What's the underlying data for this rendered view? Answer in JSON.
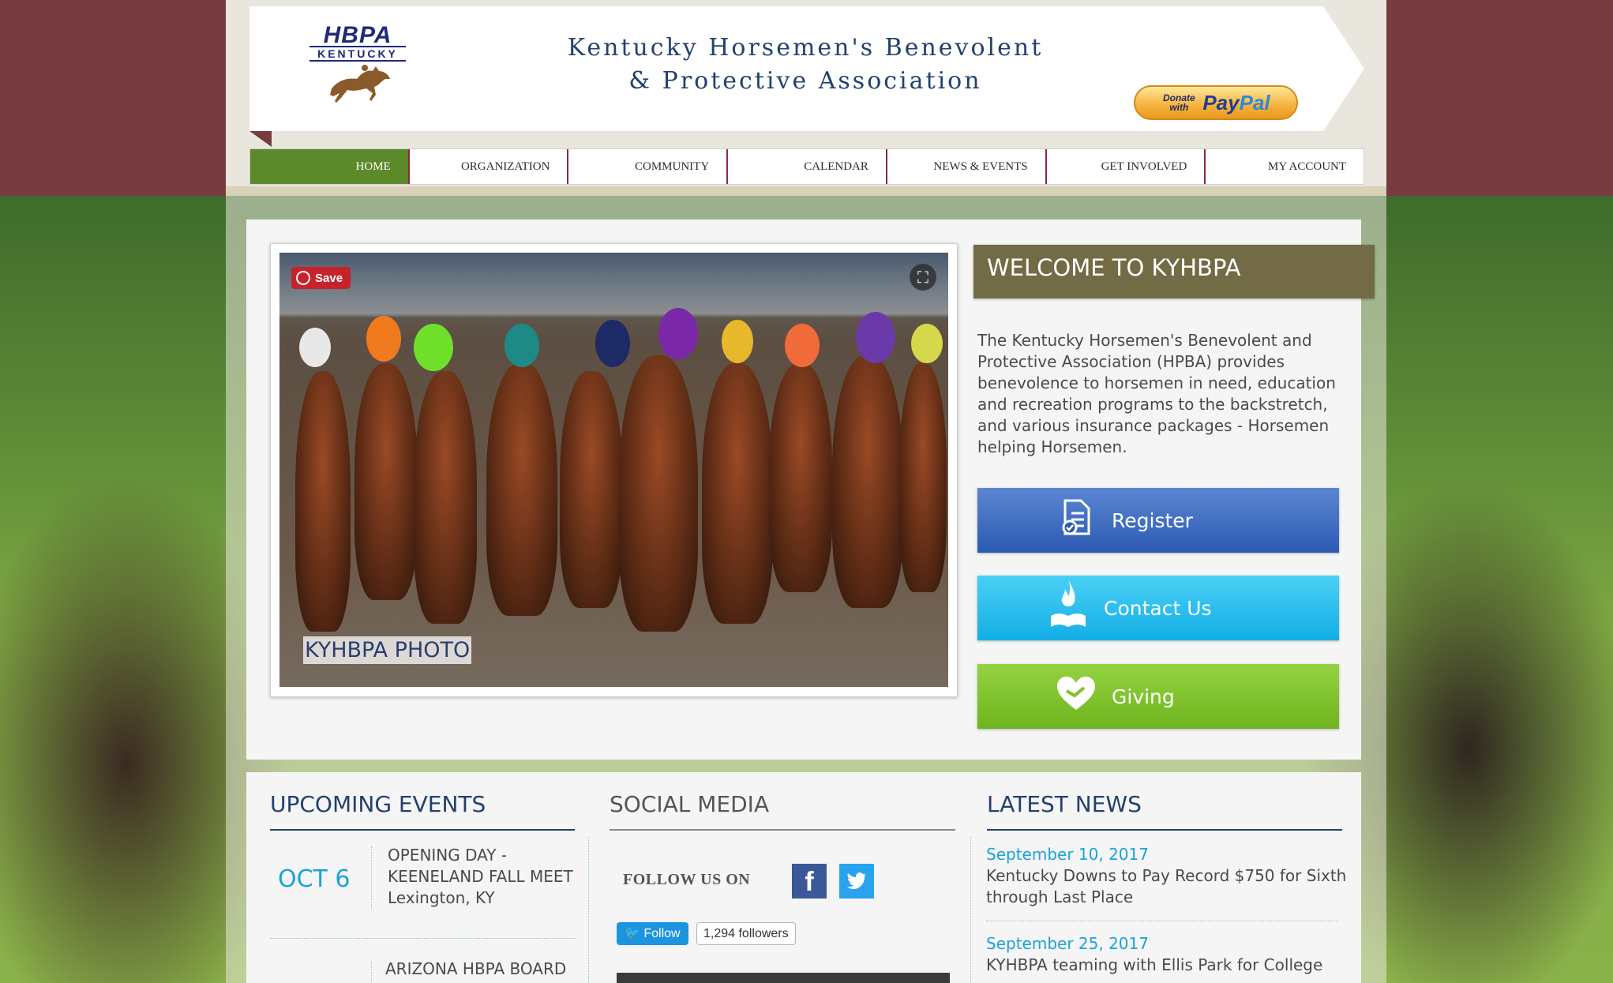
{
  "header": {
    "logo_text": "HBPA",
    "logo_subtext": "KENTUCKY",
    "site_title": "Kentucky Horsemen's Benevolent & Protective Association",
    "paypal": {
      "small": "Donate with",
      "word_a": "Pay",
      "word_b": "Pal"
    }
  },
  "nav": {
    "items": [
      {
        "label": "HOME"
      },
      {
        "label": "ORGANIZATION"
      },
      {
        "label": "COMMUNITY"
      },
      {
        "label": "CALENDAR"
      },
      {
        "label": "NEWS & EVENTS"
      },
      {
        "label": "GET INVOLVED"
      },
      {
        "label": "MY ACCOUNT"
      }
    ],
    "active_index": 0
  },
  "hero": {
    "pin_save": "Save",
    "caption": "KYHBPA PHOTO"
  },
  "welcome": {
    "title": "WELCOME TO KYHBPA",
    "text": "The Kentucky Horsemen's Benevolent and Protective Association (HPBA) provides benevolence to horsemen in need, education and recreation programs to the backstretch, and various insurance packages - Horsemen helping Horsemen.",
    "buttons": {
      "register": "Register",
      "contact": "Contact Us",
      "giving": "Giving"
    }
  },
  "events": {
    "title": "UPCOMING EVENTS",
    "items": [
      {
        "date": "OCT 6",
        "name": "OPENING DAY - KEENELAND FALL MEET",
        "location": "Lexington, KY"
      },
      {
        "date": "",
        "name": "ARIZONA HBPA BOARD",
        "location": ""
      }
    ]
  },
  "social": {
    "title": "SOCIAL MEDIA",
    "follow_label": "FOLLOW US ON",
    "twitter_follow": "Follow",
    "twitter_followers": "1,294 followers"
  },
  "news": {
    "title": "LATEST NEWS",
    "items": [
      {
        "date": "September 10, 2017",
        "headline": "Kentucky Downs to Pay Record $750 for Sixth through Last Place"
      },
      {
        "date": "September 25, 2017",
        "headline": "KYHBPA teaming with Ellis Park for College"
      }
    ]
  },
  "colors": {
    "maroon": "#763c40",
    "nav_active": "#5c8a2a",
    "welcome_bar": "#736b45",
    "register": "#2b5ab4",
    "contact": "#12aee6",
    "giving": "#6eb41e",
    "link_blue": "#1aa3d9",
    "heading_navy": "#22416e"
  },
  "icons": {
    "register": "document-check-icon",
    "contact": "flame-book-icon",
    "giving": "heart-hands-icon",
    "facebook": "facebook-icon",
    "twitter": "twitter-icon",
    "expand": "fullscreen-icon"
  }
}
